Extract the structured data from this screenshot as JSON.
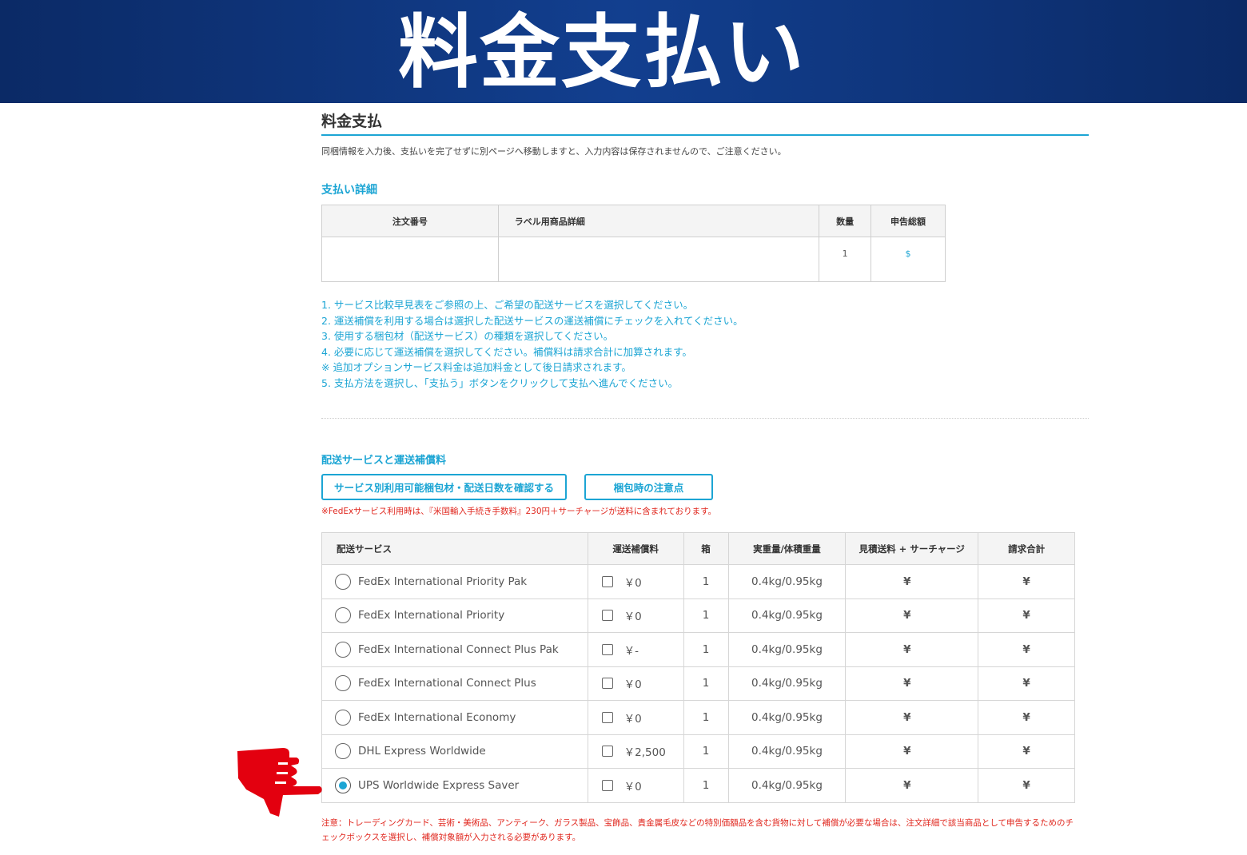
{
  "banner": {
    "title": "料金支払い"
  },
  "page": {
    "title": "料金支払",
    "notice": "同梱情報を入力後、支払いを完了せずに別ページへ移動しますと、入力内容は保存されませんので、ご注意ください。"
  },
  "payment_details": {
    "heading": "支払い詳細",
    "headers": [
      "注文番号",
      "ラベル用商品詳細",
      "数量",
      "申告総額"
    ],
    "row": {
      "order_no": "",
      "label_detail": "",
      "qty": "1",
      "total": "$"
    }
  },
  "steps": [
    "1. サービス比較早見表をご参照の上、ご希望の配送サービスを選択してください。",
    "2. 運送補償を利用する場合は選択した配送サービスの運送補償にチェックを入れてください。",
    "3. 使用する梱包材（配送サービス）の種類を選択してください。",
    "4. 必要に応じて運送補償を選択してください。補償料は請求合計に加算されます。",
    "※ 追加オプションサービス料金は追加料金として後日請求されます。",
    "5. 支払方法を選択し、「支払う」ボタンをクリックして支払へ進んでください。"
  ],
  "shipping": {
    "heading": "配送サービスと運送補償料",
    "btn_check_packaging": "サービス別利用可能梱包材・配送日数を確認する",
    "btn_packing_notes": "梱包時の注意点",
    "fedex_note": "※FedExサービス利用時は、『米国輸入手続き手数料』230円＋サーチャージが送料に含まれております。",
    "headers": [
      "配送サービス",
      "運送補償料",
      "箱",
      "実重量/体積重量",
      "見積送料 + サーチャージ",
      "請求合計"
    ],
    "rows": [
      {
        "service": "FedEx International Priority Pak",
        "insurance": "￥0",
        "boxes": "1",
        "weight": "0.4kg/0.95kg",
        "estimate": "¥",
        "total": "¥",
        "selected": false
      },
      {
        "service": "FedEx International Priority",
        "insurance": "￥0",
        "boxes": "1",
        "weight": "0.4kg/0.95kg",
        "estimate": "¥",
        "total": "¥",
        "selected": false
      },
      {
        "service": "FedEx International Connect Plus Pak",
        "insurance": "￥-",
        "boxes": "1",
        "weight": "0.4kg/0.95kg",
        "estimate": "¥",
        "total": "¥",
        "selected": false
      },
      {
        "service": "FedEx International Connect Plus",
        "insurance": "￥0",
        "boxes": "1",
        "weight": "0.4kg/0.95kg",
        "estimate": "¥",
        "total": "¥",
        "selected": false
      },
      {
        "service": "FedEx International Economy",
        "insurance": "￥0",
        "boxes": "1",
        "weight": "0.4kg/0.95kg",
        "estimate": "¥",
        "total": "¥",
        "selected": false
      },
      {
        "service": "DHL Express Worldwide",
        "insurance": "￥2,500",
        "boxes": "1",
        "weight": "0.4kg/0.95kg",
        "estimate": "¥",
        "total": "¥",
        "selected": false
      },
      {
        "service": "UPS Worldwide Express Saver",
        "insurance": "￥0",
        "boxes": "1",
        "weight": "0.4kg/0.95kg",
        "estimate": "¥",
        "total": "¥",
        "selected": true
      }
    ],
    "bottom_note": "注意：トレーディングカード、芸術・美術品、アンティーク、ガラス製品、宝飾品、貴金属毛皮などの特別価額品を含む貨物に対して補償が必要な場合は、注文詳細で該当商品として申告するためのチェックボックスを選択し、補償対象額が入力される必要があります。"
  },
  "colors": {
    "banner": "#0b2a66",
    "accent": "#1ca5d4",
    "warning": "#e0261d",
    "pointer": "#e3000f"
  },
  "icons": {
    "pointer": "pointing-hand-icon"
  }
}
